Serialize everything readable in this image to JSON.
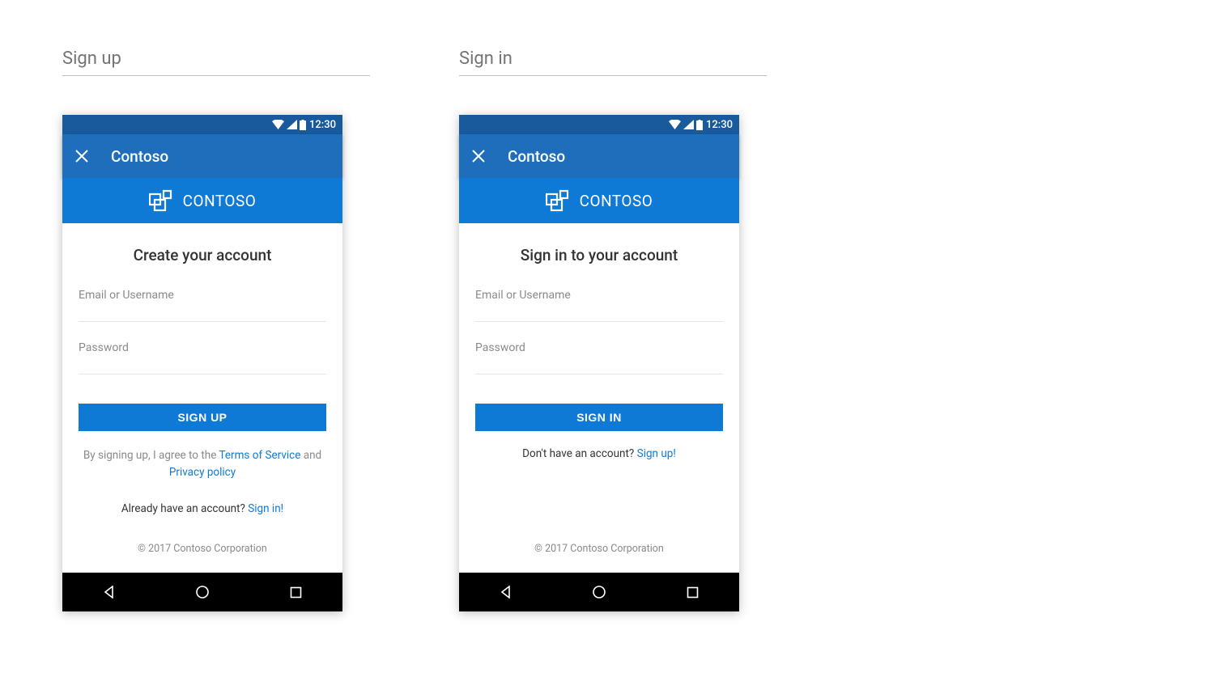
{
  "sections": {
    "signup_heading": "Sign up",
    "signin_heading": "Sign in"
  },
  "status": {
    "time": "12:30"
  },
  "appbar": {
    "title": "Contoso"
  },
  "brand": {
    "name": "CONTOSO"
  },
  "signup": {
    "title": "Create your account",
    "email_label": "Email or Username",
    "password_label": "Password",
    "button": "SIGN UP",
    "legal_prefix": "By signing up, I agree to the ",
    "terms": "Terms of Service",
    "legal_mid": " and ",
    "privacy": "Privacy policy",
    "prompt_text": "Already have an account? ",
    "prompt_link": "Sign in!"
  },
  "signin": {
    "title": "Sign in to your account",
    "email_label": "Email or Username",
    "password_label": "Password",
    "button": "SIGN IN",
    "prompt_text": "Don't have an account? ",
    "prompt_link": "Sign up!"
  },
  "footer": {
    "copyright": "© 2017 Contoso Corporation"
  }
}
